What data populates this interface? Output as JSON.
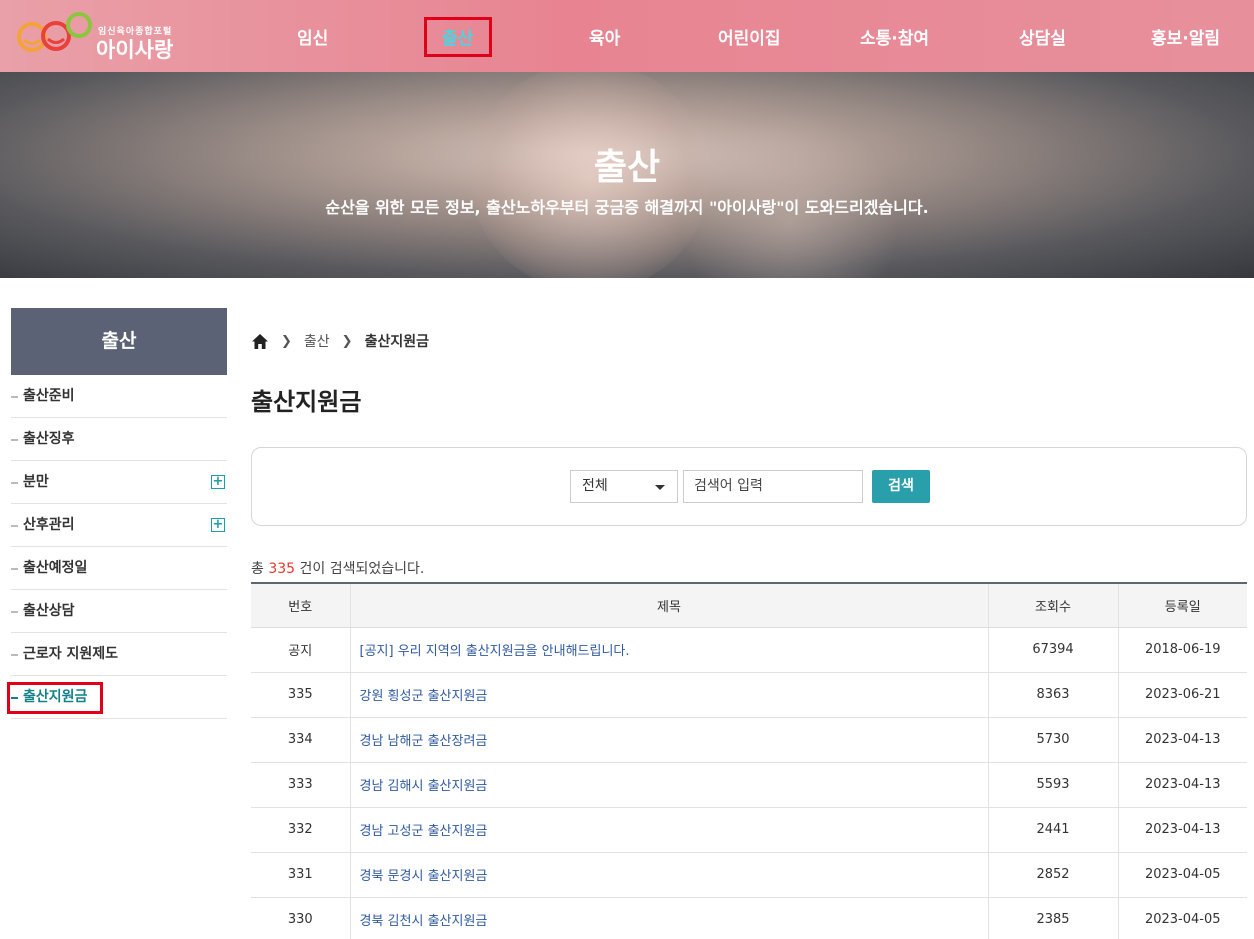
{
  "logo": {
    "tagline": "임신육아종합포털",
    "name": "아이사랑"
  },
  "nav": [
    {
      "label": "임신"
    },
    {
      "label": "출산"
    },
    {
      "label": "육아"
    },
    {
      "label": "어린이집"
    },
    {
      "label": "소통·참여"
    },
    {
      "label": "상담실"
    },
    {
      "label": "홍보·알림"
    }
  ],
  "hero": {
    "title": "출산",
    "subtitle": "순산을 위한 모든 정보, 출산노하우부터 궁금증 해결까지 \"아이사랑\"이 도와드리겠습니다."
  },
  "sidebar": {
    "title": "출산",
    "items": [
      {
        "label": "출산준비"
      },
      {
        "label": "출산징후"
      },
      {
        "label": "분만"
      },
      {
        "label": "산후관리"
      },
      {
        "label": "출산예정일"
      },
      {
        "label": "출산상담"
      },
      {
        "label": "근로자 지원제도"
      },
      {
        "label": "출산지원금"
      }
    ]
  },
  "breadcrumb": {
    "level1": "출산",
    "level2": "출산지원금"
  },
  "page_title": "출산지원금",
  "search": {
    "scope": "전체",
    "placeholder": "검색어 입력",
    "button": "검색"
  },
  "result": {
    "prefix": "총",
    "count": "335",
    "suffix": "건이 검색되었습니다."
  },
  "table": {
    "headers": {
      "no": "번호",
      "title": "제목",
      "views": "조회수",
      "date": "등록일"
    },
    "rows": [
      {
        "no": "공지",
        "title": "[공지] 우리 지역의 출산지원금을 안내해드립니다.",
        "views": "67394",
        "date": "2018-06-19"
      },
      {
        "no": "335",
        "title": "강원 횡성군 출산지원금",
        "views": "8363",
        "date": "2023-06-21"
      },
      {
        "no": "334",
        "title": "경남 남해군 출산장려금",
        "views": "5730",
        "date": "2023-04-13"
      },
      {
        "no": "333",
        "title": "경남 김해시 출산지원금",
        "views": "5593",
        "date": "2023-04-13"
      },
      {
        "no": "332",
        "title": "경남 고성군 출산지원금",
        "views": "2441",
        "date": "2023-04-13"
      },
      {
        "no": "331",
        "title": "경북 문경시 출산지원금",
        "views": "2852",
        "date": "2023-04-05"
      },
      {
        "no": "330",
        "title": "경북 김천시 출산지원금",
        "views": "2385",
        "date": "2023-04-05"
      }
    ]
  },
  "colors": {
    "header_pink": "#e88492",
    "active_nav": "#4ed3e0",
    "sidebar_head": "#5c6275",
    "accent_teal": "#2a9fac",
    "count_red": "#e03b2d",
    "link_blue": "#2f5aa0"
  }
}
